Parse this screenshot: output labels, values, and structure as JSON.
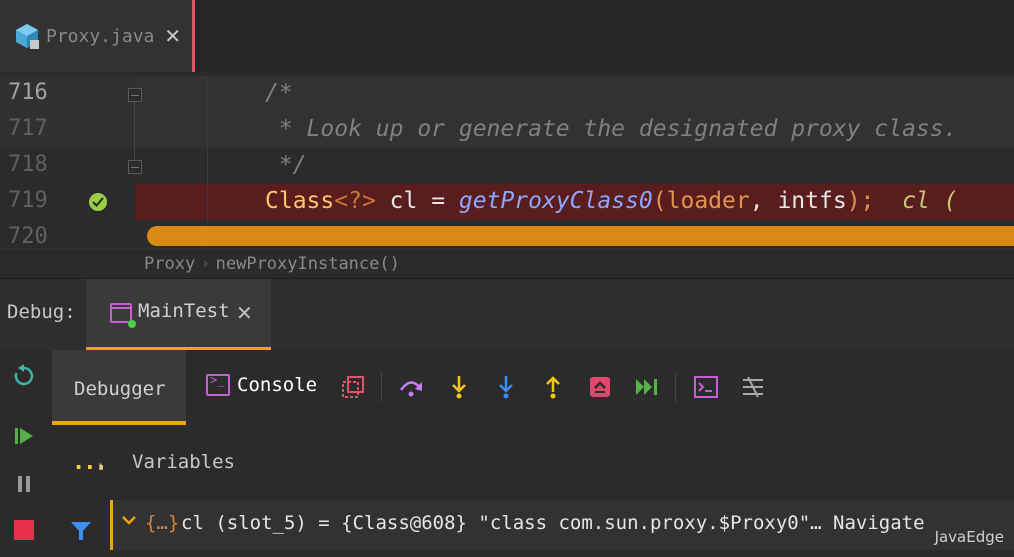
{
  "editor_tab": {
    "filename": "Proxy.java",
    "close": "✕"
  },
  "editor": {
    "lines": [
      {
        "num": "716",
        "code": "/*"
      },
      {
        "num": "717",
        "code": " * Look up or generate the designated proxy class."
      },
      {
        "num": "718",
        "code": " */"
      },
      {
        "num": "719",
        "tokens": {
          "type": "Class",
          "generic": "<?>",
          "var": " cl ",
          "eq": "=",
          "sp": " ",
          "method": "getProxyClass0",
          "open": "(",
          "arg1": "loader",
          "comma": ", ",
          "arg2": "intfs",
          "close": ");",
          "hint": "  cl ("
        }
      },
      {
        "num": "720",
        "code": ""
      }
    ]
  },
  "breadcrumb": {
    "items": [
      "Proxy",
      "newProxyInstance()"
    ],
    "sep": "›"
  },
  "debug": {
    "label": "Debug:",
    "run_tab": "MainTest",
    "run_close": "✕",
    "debugger_tab": "Debugger",
    "console_tab": "Console",
    "variables_label": "Variables",
    "variables_dots": "...",
    "variables_count": "1"
  },
  "variable": {
    "icon": "{…}",
    "text": "cl (slot_5) = {Class@608} \"class com.sun.proxy.$Proxy0\"… Navigate"
  },
  "watermark": "JavaEdge",
  "colors": {
    "accent": "#f0a30a",
    "breakpoint_line": "#5a1d1d",
    "tab_marker": "#e05565"
  },
  "icons": {
    "file": "java-class-icon",
    "toolbar": [
      "restore-layout-icon",
      "step-over-icon",
      "step-into-icon",
      "force-step-into-icon",
      "step-out-icon",
      "drop-frame-icon",
      "run-to-cursor-icon",
      "evaluate-expression-icon",
      "trace-icon"
    ],
    "rail": [
      "rerun-icon",
      "resume-icon",
      "pause-icon",
      "stop-icon"
    ]
  }
}
